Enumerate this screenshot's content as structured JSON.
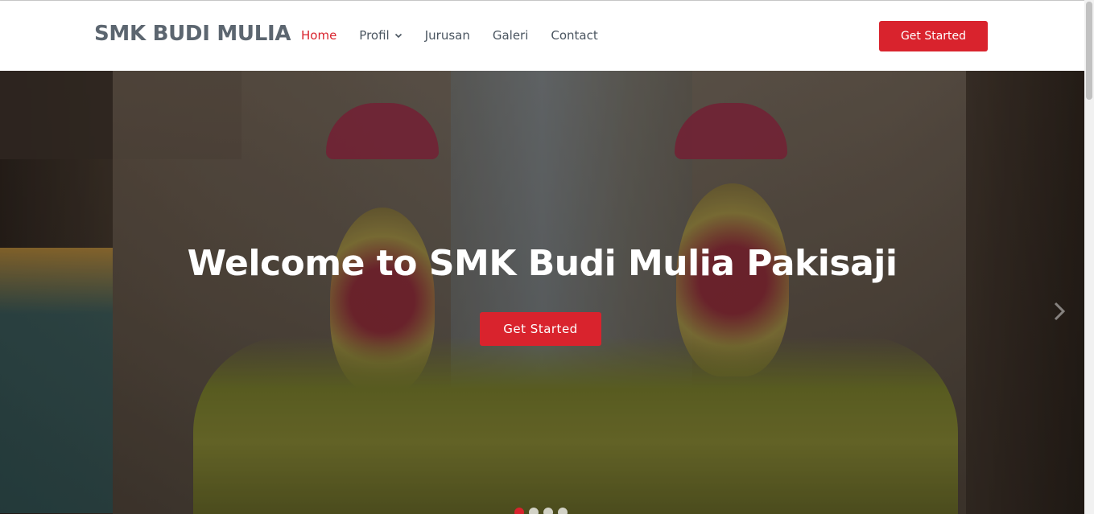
{
  "header": {
    "logo": "SMK BUDI MULIA",
    "nav": [
      {
        "label": "Home",
        "active": true
      },
      {
        "label": "Profil",
        "dropdown": true
      },
      {
        "label": "Jurusan"
      },
      {
        "label": "Galeri"
      },
      {
        "label": "Contact"
      }
    ],
    "cta_label": "Get Started"
  },
  "hero": {
    "title": "Welcome to SMK Budi Mulia Pakisaji",
    "cta_label": "Get Started",
    "next_icon": "chevron-right-icon",
    "slides": 4,
    "active_slide": 1
  },
  "colors": {
    "accent": "#d9232d",
    "logo": "#5c6670",
    "nav_text": "#4a5560"
  }
}
